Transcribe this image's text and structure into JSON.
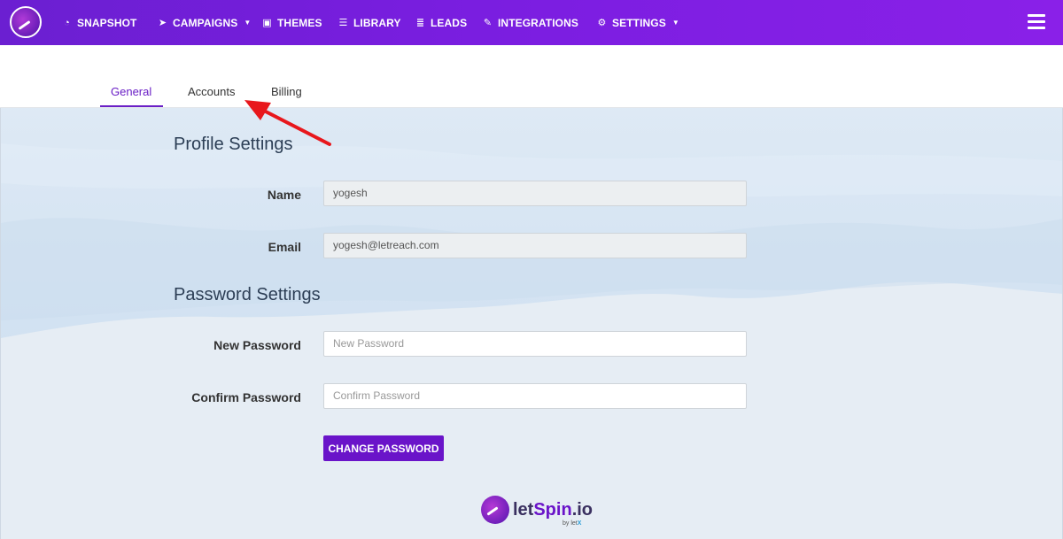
{
  "navbar": {
    "items": [
      {
        "label": "SNAPSHOT",
        "icon": "dashboard-icon"
      },
      {
        "label": "CAMPAIGNS",
        "icon": "paper-plane-icon",
        "dropdown": true
      },
      {
        "label": "THEMES",
        "icon": "image-icon"
      },
      {
        "label": "LIBRARY",
        "icon": "list-icon"
      },
      {
        "label": "LEADS",
        "icon": "table-icon"
      },
      {
        "label": "INTEGRATIONS",
        "icon": "plug-icon"
      },
      {
        "label": "SETTINGS",
        "icon": "cogs-icon",
        "dropdown": true
      }
    ]
  },
  "tabs": [
    {
      "label": "General",
      "active": true
    },
    {
      "label": "Accounts",
      "active": false
    },
    {
      "label": "Billing",
      "active": false
    }
  ],
  "profile": {
    "title": "Profile Settings",
    "name_label": "Name",
    "name_value": "yogesh",
    "email_label": "Email",
    "email_value": "yogesh@letreach.com"
  },
  "password": {
    "title": "Password Settings",
    "new_label": "New Password",
    "new_placeholder": "New Password",
    "confirm_label": "Confirm Password",
    "confirm_placeholder": "Confirm Password",
    "button_label": "CHANGE PASSWORD"
  },
  "footer_logo": {
    "name_part1": "let",
    "name_part2": "Spin",
    "name_part3": ".io",
    "by_text": "by let",
    "by_x": "X"
  },
  "colors": {
    "nav_gradient_start": "#6b1fd1",
    "nav_gradient_end": "#8a20e8",
    "accent": "#6a14c9",
    "annotation_arrow": "#e8171c"
  }
}
